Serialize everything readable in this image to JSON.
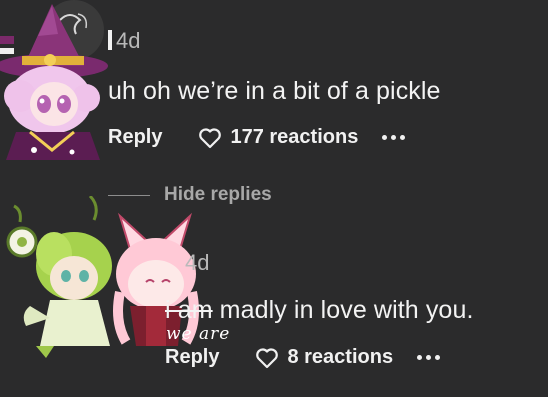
{
  "comments": [
    {
      "timestamp": "4d",
      "text": "uh oh we’re in a bit of a pickle",
      "reply_label": "Reply",
      "reactions_label": "177 reactions"
    }
  ],
  "hide_replies_label": "Hide replies",
  "replies": [
    {
      "timestamp": "4d",
      "text_struck": "i am",
      "text_rest": " madly in love with you.",
      "handwritten_correction": "we are",
      "reply_label": "Reply",
      "reactions_label": "8 reactions"
    }
  ],
  "icons": {
    "reaction": "heart-outline-icon",
    "more": "more-dots-icon"
  },
  "colors": {
    "background": "#2b2b2c",
    "text": "#f3f3f3",
    "muted": "#b9b9b9"
  }
}
